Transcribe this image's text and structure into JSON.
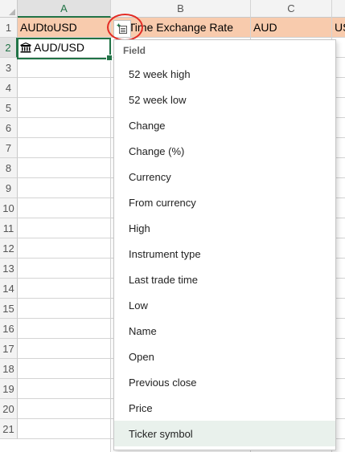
{
  "grid": {
    "columns": [
      "A",
      "B",
      "C"
    ],
    "rows": [
      "1",
      "2",
      "3",
      "4",
      "5",
      "6",
      "7",
      "8",
      "9",
      "10",
      "11",
      "12",
      "13",
      "14",
      "15",
      "16",
      "17",
      "18",
      "19",
      "20",
      "21"
    ],
    "row1": {
      "a": "AUDtoUSD",
      "b": "l-Time Exchange Rate",
      "c": "AUD",
      "d": "US"
    },
    "row2": {
      "a": "AUD/USD"
    }
  },
  "icons": {
    "stock": "bank-building-icon",
    "insert_data": "insert-data-icon"
  },
  "colors": {
    "header_fill": "#f8cbad",
    "selection": "#217346",
    "highlight_ring": "#e32b24",
    "hover": "#e9f1ec"
  },
  "dropdown": {
    "header": "Field",
    "items": [
      "52 week high",
      "52 week low",
      "Change",
      "Change (%)",
      "Currency",
      "From currency",
      "High",
      "Instrument type",
      "Last trade time",
      "Low",
      "Name",
      "Open",
      "Previous close",
      "Price",
      "Ticker symbol"
    ],
    "hovered_item": "Ticker symbol"
  }
}
